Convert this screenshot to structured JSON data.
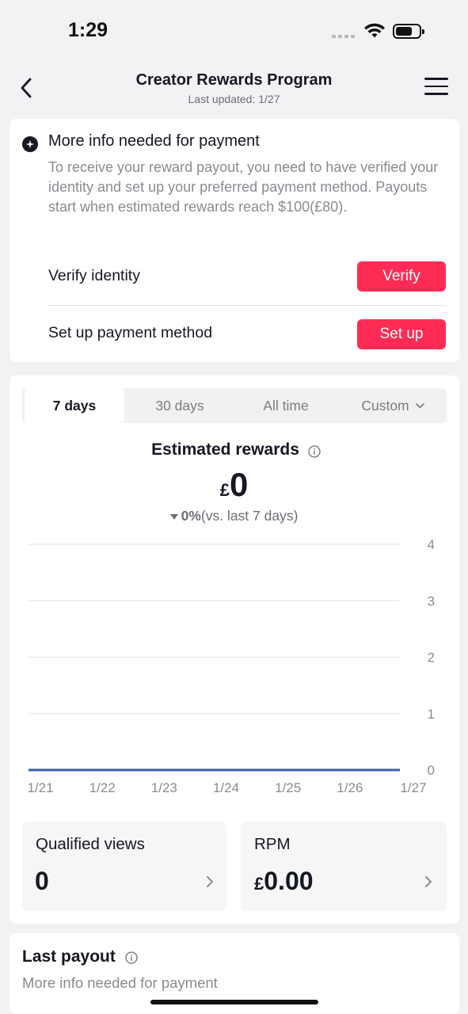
{
  "status_bar": {
    "time": "1:29"
  },
  "header": {
    "title": "Creator Rewards Program",
    "subtitle": "Last updated: 1/27"
  },
  "payment_notice": {
    "title": "More info needed for payment",
    "body": "To receive your reward payout, you need to have verified your identity and set up your preferred payment method. Payouts start when estimated rewards reach $100(£80).",
    "verify_label": "Verify identity",
    "verify_button": "Verify",
    "payment_label": "Set up payment method",
    "payment_button": "Set up"
  },
  "tabs": [
    {
      "label": "7 days",
      "active": true
    },
    {
      "label": "30 days",
      "active": false
    },
    {
      "label": "All time",
      "active": false
    },
    {
      "label": "Custom",
      "active": false
    }
  ],
  "rewards": {
    "label": "Estimated rewards",
    "currency": "£",
    "value": "0",
    "change": "0%",
    "change_suffix": "(vs. last 7 days)"
  },
  "chart_data": {
    "type": "line",
    "x": [
      "1/21",
      "1/22",
      "1/23",
      "1/24",
      "1/25",
      "1/26",
      "1/27"
    ],
    "series": [
      {
        "values": [
          0,
          0,
          0,
          0,
          0,
          0,
          0
        ]
      }
    ],
    "y_ticks": [
      "0",
      "1",
      "2",
      "3",
      "4"
    ],
    "ylim": [
      0,
      4
    ],
    "grid": true,
    "line_color": "#3a5fa8"
  },
  "metrics": {
    "views_label": "Qualified views",
    "views_value": "0",
    "rpm_label": "RPM",
    "rpm_currency": "£",
    "rpm_value": "0.00"
  },
  "last_payout": {
    "title": "Last payout",
    "subtitle": "More info needed for payment"
  },
  "colors": {
    "accent": "#fe2c55"
  }
}
